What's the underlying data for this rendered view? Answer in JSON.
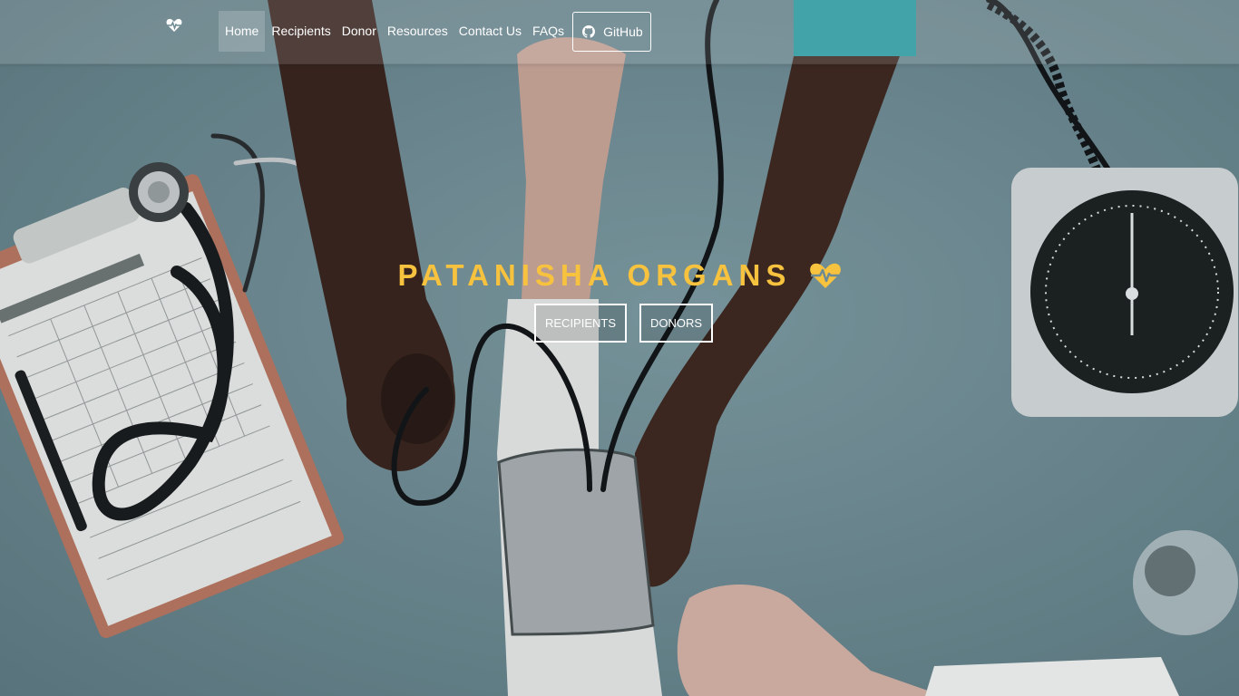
{
  "navbar": {
    "brand_icon": "heartbeat-icon",
    "links": [
      {
        "label": "Home",
        "active": true
      },
      {
        "label": "Recipients"
      },
      {
        "label": "Donor"
      },
      {
        "label": "Resources"
      },
      {
        "label": "Contact Us"
      },
      {
        "label": "FAQs"
      }
    ],
    "github": {
      "label": "GitHub",
      "icon": "github-icon"
    }
  },
  "hero": {
    "title": "PATANISHA ORGANS",
    "title_icon": "heartbeat-icon",
    "title_color": "#f7c23d",
    "buttons": [
      "RECIPIENTS",
      "DONORS"
    ],
    "background": "doctor measuring patient blood pressure on teal desk"
  }
}
